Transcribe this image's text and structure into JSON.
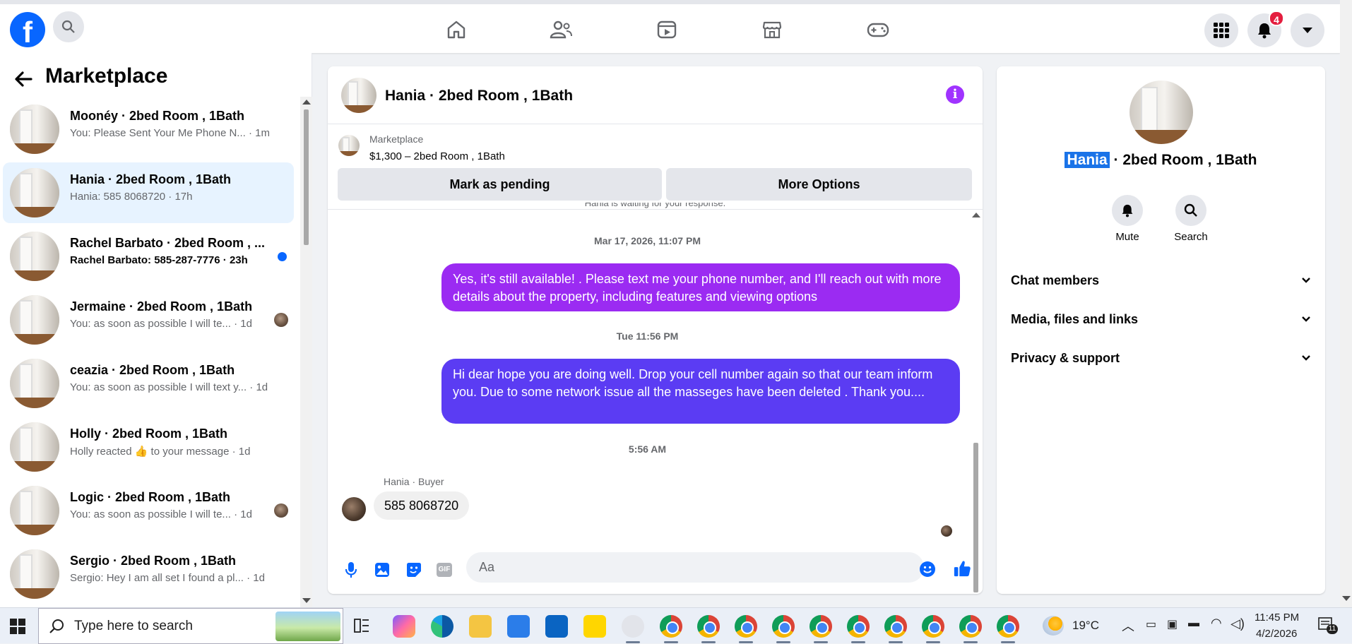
{
  "topbar": {
    "logo": "f",
    "notifications_count": "4",
    "nav_icons": [
      "home-icon",
      "friends-icon",
      "video-icon",
      "marketplace-icon",
      "gaming-icon"
    ]
  },
  "sidebar": {
    "title": "Marketplace",
    "conversations": [
      {
        "name": "Moonéy · 2bed Room , 1Bath",
        "preview": "You: Please Sent Your Me Phone N... · 1m",
        "active": false,
        "unread": false
      },
      {
        "name": "Hania · 2bed Room , 1Bath",
        "preview": "Hania: 585 8068720 · 17h",
        "active": true,
        "unread": false
      },
      {
        "name": "Rachel Barbato · 2bed Room , ...",
        "preview": "Rachel Barbato: 585-287-7776 · 23h",
        "active": false,
        "unread": true
      },
      {
        "name": "Jermaine · 2bed Room , 1Bath",
        "preview": "You: as soon as possible I will te... · 1d",
        "active": false,
        "unread": false
      },
      {
        "name": "ceazia · 2bed Room , 1Bath",
        "preview": "You: as soon as possible I will text y... · 1d",
        "active": false,
        "unread": false
      },
      {
        "name": "Holly · 2bed Room , 1Bath",
        "preview": "Holly reacted 👍 to your message · 1d",
        "active": false,
        "unread": false
      },
      {
        "name": "Logic · 2bed Room , 1Bath",
        "preview": "You: as soon as possible I will te... · 1d",
        "active": false,
        "unread": false
      },
      {
        "name": "Sergio · 2bed Room , 1Bath",
        "preview": "Sergio: Hey I am all set I found a pl... · 1d",
        "active": false,
        "unread": false
      }
    ]
  },
  "chat": {
    "title": "Hania · 2bed Room , 1Bath",
    "listing": {
      "source": "Marketplace",
      "price_title": "$1,300 – 2bed Room , 1Bath",
      "mark_pending_label": "Mark as pending",
      "more_options_label": "More Options"
    },
    "waiting_notice": "Hania is waiting for your response.",
    "messages": [
      {
        "timestamp": "Mar 17, 2026, 11:07 PM",
        "text": "Yes, it's still available! . Please text me your phone number, and I'll reach out with more details about the property, including features and viewing options",
        "color": "#9b2bf2"
      },
      {
        "timestamp": "Tue 11:56 PM",
        "text": "Hi dear hope you are doing well.  Drop your cell number again so that our team inform you.  Due to some network issue all the masseges have been deleted . Thank you....",
        "color": "#5b3cf3"
      }
    ],
    "buyer_timestamp": "5:56 AM",
    "buyer_label": "Hania · Buyer",
    "buyer_message": "585 8068720",
    "composer_placeholder": "Aa",
    "gif_label": "GIF"
  },
  "details": {
    "title_highlight": "Hania",
    "title_rest": " · 2bed Room , 1Bath",
    "mute_label": "Mute",
    "search_label": "Search",
    "sections": [
      "Chat members",
      "Media, files and links",
      "Privacy & support"
    ]
  },
  "taskbar": {
    "search_placeholder": "Type here to search",
    "weather": "19°C",
    "time": "11:45 PM",
    "date": "4/2/2026",
    "notification_count": "11"
  },
  "colors": {
    "accent": "#0866ff",
    "bubble_purple": "#9b2bf2",
    "bubble_blue": "#5b3cf3",
    "active_row": "#e7f3ff"
  }
}
